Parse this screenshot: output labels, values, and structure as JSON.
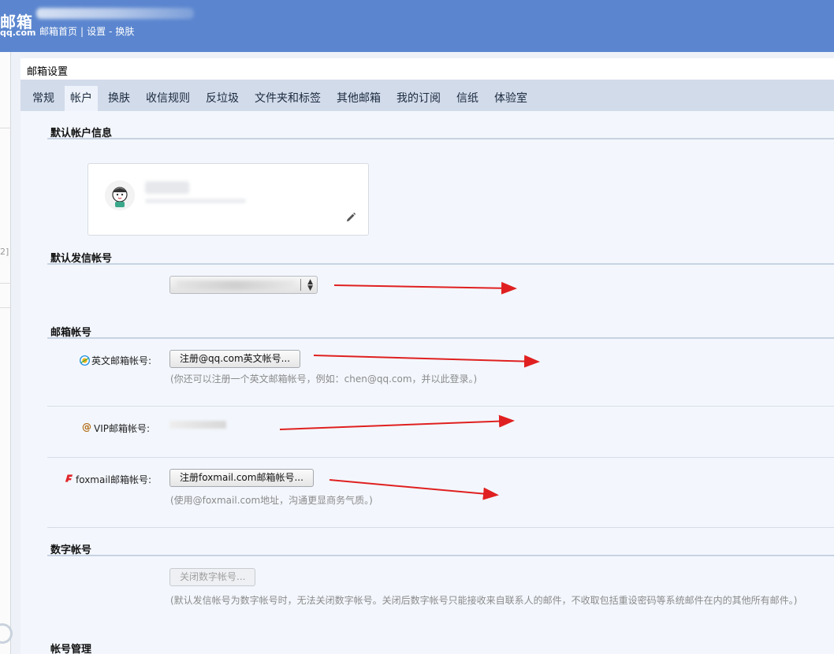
{
  "header": {
    "logo": "邮箱",
    "logo_domain": "qq.com",
    "links": [
      "邮箱首页",
      "设置",
      "换肤"
    ],
    "link_separators": [
      "|",
      "-"
    ]
  },
  "page": {
    "title": "邮箱设置"
  },
  "tabs": [
    {
      "label": "常规",
      "active": false
    },
    {
      "label": "帐户",
      "active": true
    },
    {
      "label": "换肤",
      "active": false
    },
    {
      "label": "收信规则",
      "active": false
    },
    {
      "label": "反垃圾",
      "active": false
    },
    {
      "label": "文件夹和标签",
      "active": false
    },
    {
      "label": "其他邮箱",
      "active": false
    },
    {
      "label": "我的订阅",
      "active": false
    },
    {
      "label": "信纸",
      "active": false
    },
    {
      "label": "体验室",
      "active": false
    }
  ],
  "sections": {
    "default_account": {
      "title": "默认帐户信息"
    },
    "default_sender": {
      "title": "默认发信帐号"
    },
    "mailbox_account": {
      "title": "邮箱帐号",
      "english": {
        "label": "英文邮箱帐号:",
        "button": "注册@qq.com英文帐号...",
        "hint": "(你还可以注册一个英文邮箱帐号，例如：chen@qq.com，并以此登录。)"
      },
      "vip": {
        "label": "VIP邮箱帐号:",
        "at_symbol": "@"
      },
      "foxmail": {
        "label": "foxmail邮箱帐号:",
        "button": "注册foxmail.com邮箱帐号...",
        "hint": "(使用@foxmail.com地址，沟通更显商务气质。)"
      }
    },
    "digital_account": {
      "title": "数字帐号",
      "button": "关闭数字帐号...",
      "hint": "(默认发信帐号为数字帐号时，无法关闭数字帐号。关闭后数字帐号只能接收来自联系人的邮件，不收取包括重设密码等系统邮件在内的其他所有邮件。)"
    },
    "account_management": {
      "title": "帐号管理"
    }
  },
  "sidebar": {
    "bracket_fragment": "2]"
  },
  "colors": {
    "header_bg": "#5b86cf",
    "tab_bar": "#d2dbea",
    "content_bg": "#f3f7fd",
    "annotation_arrow": "#e02020"
  },
  "icons": {
    "card_edit": "pencil-icon",
    "english_account": "qq-icon",
    "vip_account": "at-sign-icon",
    "foxmail_account": "foxmail-icon"
  }
}
